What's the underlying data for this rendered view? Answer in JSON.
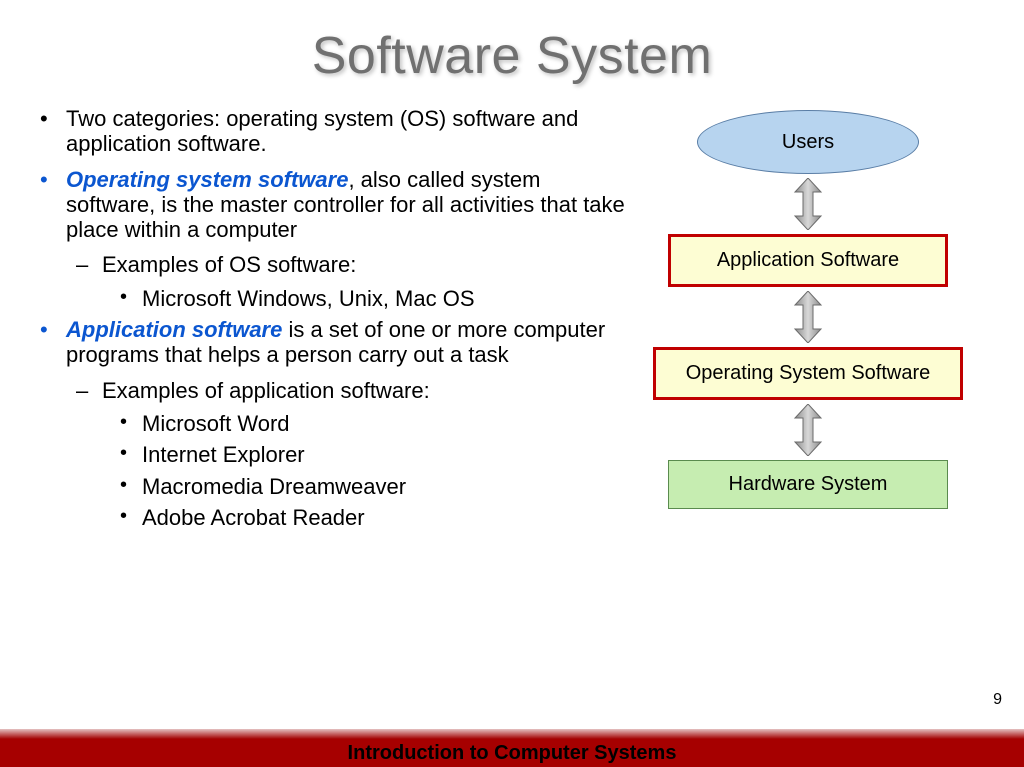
{
  "title": "Software System",
  "bullets": {
    "b1": "Two categories:  operating system (OS) software and application software.",
    "b2_emph": "Operating system software",
    "b2_rest": ", also called system software, is the master controller for all activities that take place within a computer",
    "b2a": "Examples of OS software:",
    "b2a1": "Microsoft Windows, Unix, Mac OS",
    "b3_emph": "Application software",
    "b3_rest": " is a set of one or more computer programs that helps a person carry out a task",
    "b3a": "Examples of application software:",
    "b3a1": "Microsoft Word",
    "b3a2": "Internet Explorer",
    "b3a3": "Macromedia Dreamweaver",
    "b3a4": "Adobe Acrobat Reader"
  },
  "diagram": {
    "node1": "Users",
    "node2": "Application Software",
    "node3": "Operating System Software",
    "node4": "Hardware System"
  },
  "page_number": "9",
  "footer": "Introduction to Computer Systems"
}
